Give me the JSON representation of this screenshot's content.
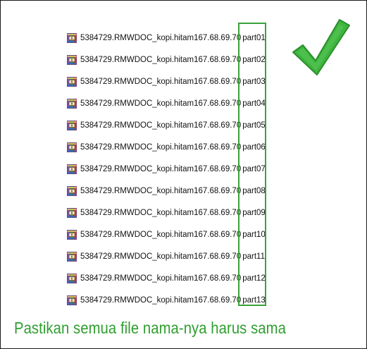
{
  "files": [
    {
      "base": "5384729.RMWDOC_kopi.hitam167.68.69.70",
      "part": "part01"
    },
    {
      "base": "5384729.RMWDOC_kopi.hitam167.68.69.70",
      "part": "part02"
    },
    {
      "base": "5384729.RMWDOC_kopi.hitam167.68.69.70",
      "part": "part03"
    },
    {
      "base": "5384729.RMWDOC_kopi.hitam167.68.69.70",
      "part": "part04"
    },
    {
      "base": "5384729.RMWDOC_kopi.hitam167.68.69.70",
      "part": "part05"
    },
    {
      "base": "5384729.RMWDOC_kopi.hitam167.68.69.70",
      "part": "part06"
    },
    {
      "base": "5384729.RMWDOC_kopi.hitam167.68.69.70",
      "part": "part07"
    },
    {
      "base": "5384729.RMWDOC_kopi.hitam167.68.69.70",
      "part": "part08"
    },
    {
      "base": "5384729.RMWDOC_kopi.hitam167.68.69.70",
      "part": "part09"
    },
    {
      "base": "5384729.RMWDOC_kopi.hitam167.68.69.70",
      "part": "part10"
    },
    {
      "base": "5384729.RMWDOC_kopi.hitam167.68.69.70",
      "part": "part11"
    },
    {
      "base": "5384729.RMWDOC_kopi.hitam167.68.69.70",
      "part": "part12"
    },
    {
      "base": "5384729.RMWDOC_kopi.hitam167.68.69.70",
      "part": "part13"
    }
  ],
  "caption": "Pastikan semua file nama-nya harus sama",
  "icons": {
    "file": "winrar-archive-icon",
    "check": "green-checkmark-icon"
  },
  "colors": {
    "accent_green": "#3aa23a",
    "caption_green": "#2f9e2f",
    "text": "#111111"
  }
}
